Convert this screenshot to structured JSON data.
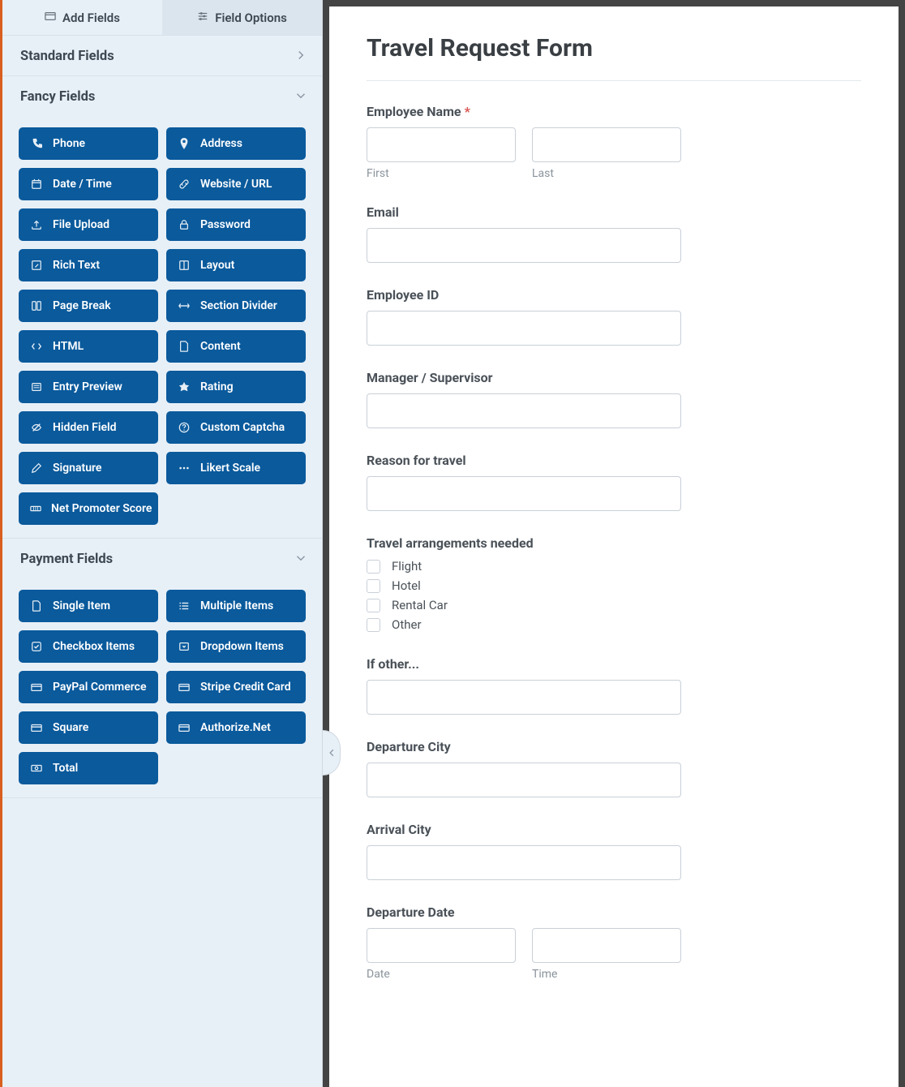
{
  "tabs": {
    "add_fields": "Add Fields",
    "field_options": "Field Options"
  },
  "sections": {
    "standard": {
      "title": "Standard Fields"
    },
    "fancy": {
      "title": "Fancy Fields",
      "items": [
        {
          "icon": "phone",
          "label": "Phone"
        },
        {
          "icon": "pin",
          "label": "Address"
        },
        {
          "icon": "calendar",
          "label": "Date / Time"
        },
        {
          "icon": "link",
          "label": "Website / URL"
        },
        {
          "icon": "upload",
          "label": "File Upload"
        },
        {
          "icon": "lock",
          "label": "Password"
        },
        {
          "icon": "edit",
          "label": "Rich Text"
        },
        {
          "icon": "layout",
          "label": "Layout"
        },
        {
          "icon": "pagebreak",
          "label": "Page Break"
        },
        {
          "icon": "divider",
          "label": "Section Divider"
        },
        {
          "icon": "code",
          "label": "HTML"
        },
        {
          "icon": "file",
          "label": "Content"
        },
        {
          "icon": "preview",
          "label": "Entry Preview"
        },
        {
          "icon": "star",
          "label": "Rating"
        },
        {
          "icon": "hidden",
          "label": "Hidden Field"
        },
        {
          "icon": "question",
          "label": "Custom Captcha"
        },
        {
          "icon": "pencil",
          "label": "Signature"
        },
        {
          "icon": "dots",
          "label": "Likert Scale"
        },
        {
          "icon": "nps",
          "label": "Net Promoter Score"
        }
      ]
    },
    "payment": {
      "title": "Payment Fields",
      "items": [
        {
          "icon": "file",
          "label": "Single Item"
        },
        {
          "icon": "list",
          "label": "Multiple Items"
        },
        {
          "icon": "check",
          "label": "Checkbox Items"
        },
        {
          "icon": "dropdown",
          "label": "Dropdown Items"
        },
        {
          "icon": "card",
          "label": "PayPal Commerce"
        },
        {
          "icon": "card",
          "label": "Stripe Credit Card"
        },
        {
          "icon": "card",
          "label": "Square"
        },
        {
          "icon": "card",
          "label": "Authorize.Net"
        },
        {
          "icon": "money",
          "label": "Total"
        }
      ]
    }
  },
  "form": {
    "title": "Travel Request Form",
    "employee_name": {
      "label": "Employee Name",
      "first": "First",
      "last": "Last"
    },
    "email": {
      "label": "Email"
    },
    "employee_id": {
      "label": "Employee ID"
    },
    "manager": {
      "label": "Manager / Supervisor"
    },
    "reason": {
      "label": "Reason for travel"
    },
    "arrangements": {
      "label": "Travel arrangements needed",
      "options": [
        "Flight",
        "Hotel",
        "Rental Car",
        "Other"
      ]
    },
    "if_other": {
      "label": "If other..."
    },
    "departure_city": {
      "label": "Departure City"
    },
    "arrival_city": {
      "label": "Arrival City"
    },
    "departure_date": {
      "label": "Departure Date",
      "date": "Date",
      "time": "Time"
    }
  }
}
